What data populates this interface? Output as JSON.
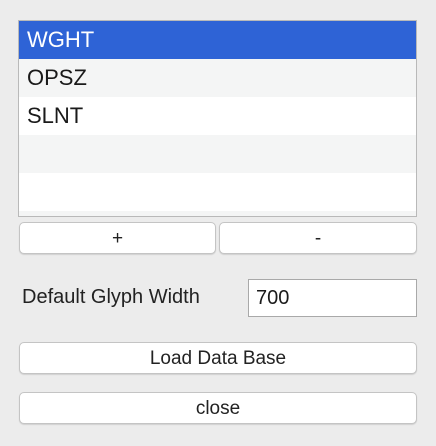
{
  "axes_list": {
    "items": [
      {
        "label": "WGHT",
        "selected": true
      },
      {
        "label": "OPSZ",
        "selected": false
      },
      {
        "label": "SLNT",
        "selected": false
      }
    ]
  },
  "buttons": {
    "add_label": "+",
    "remove_label": "-",
    "load_label": "Load Data Base",
    "close_label": "close"
  },
  "glyph_width": {
    "label": "Default Glyph Width",
    "value": "700"
  },
  "colors": {
    "selection": "#2e63d6",
    "background": "#ececec"
  }
}
